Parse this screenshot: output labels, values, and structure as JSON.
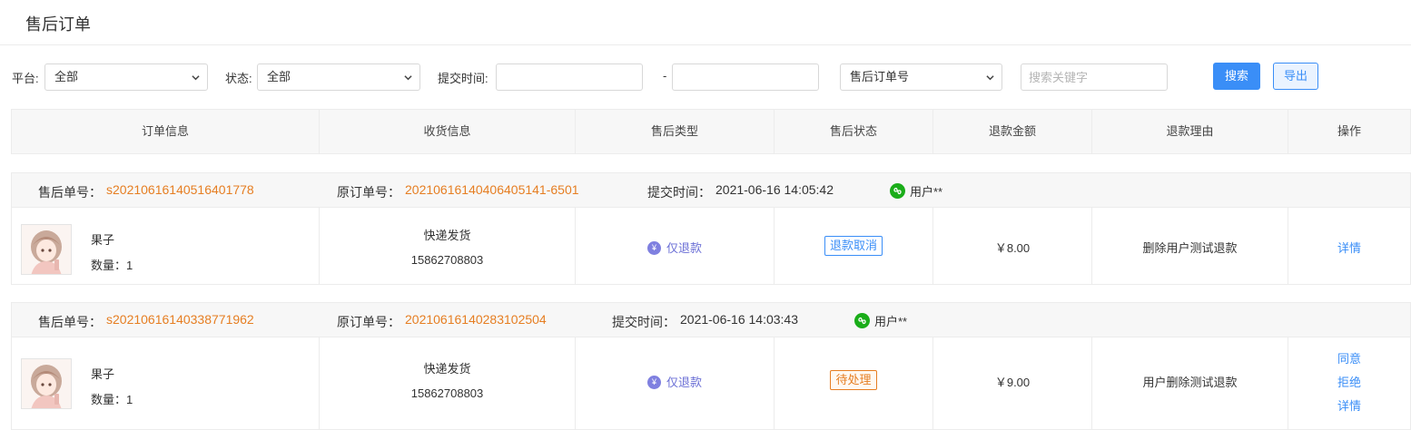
{
  "page": {
    "title": "售后订单"
  },
  "filters": {
    "platform_label": "平台:",
    "platform_value": "全部",
    "status_label": "状态:",
    "status_value": "全部",
    "submit_time_label": "提交时间:",
    "date_separator": "-",
    "search_field_value": "售后订单号",
    "keyword_placeholder": "搜索关键字",
    "search_button": "搜索",
    "export_button": "导出"
  },
  "table": {
    "columns": [
      "订单信息",
      "收货信息",
      "售后类型",
      "售后状态",
      "退款金额",
      "退款理由",
      "操作"
    ]
  },
  "labels": {
    "aftersale_no": "售后单号：",
    "original_no": "原订单号：",
    "submit_time": "提交时间：",
    "qty_prefix": "数量："
  },
  "orders": [
    {
      "aftersale_no": "s20210616140516401778",
      "original_no": "20210616140406405141-6501",
      "submit_time": "2021-06-16 14:05:42",
      "user": "用户**",
      "product_name": "果子",
      "quantity": "1",
      "delivery_method": "快递发货",
      "phone": "15862708803",
      "type": "仅退款",
      "status": "退款取消",
      "status_color": "#3a8ef7",
      "amount": "￥8.00",
      "reason": "删除用户测试退款",
      "actions": [
        "详情"
      ]
    },
    {
      "aftersale_no": "s20210616140338771962",
      "original_no": "20210616140283102504",
      "submit_time": "2021-06-16 14:03:43",
      "user": "用户**",
      "product_name": "果子",
      "quantity": "1",
      "delivery_method": "快递发货",
      "phone": "15862708803",
      "type": "仅退款",
      "status": "待处理",
      "status_color": "#e67e22",
      "amount": "￥9.00",
      "reason": "用户删除测试退款",
      "actions": [
        "同意",
        "拒绝",
        "详情"
      ]
    }
  ],
  "icons": {
    "wechat_icon": "wechat-mini-program-icon",
    "refund_icon": "yen-coin-icon",
    "yen_glyph": "¥"
  },
  "colors": {
    "accent": "#3a8ef7",
    "order_no": "#e67e22",
    "refund_type": "#6b6fd6",
    "wechat": "#1aad19"
  }
}
